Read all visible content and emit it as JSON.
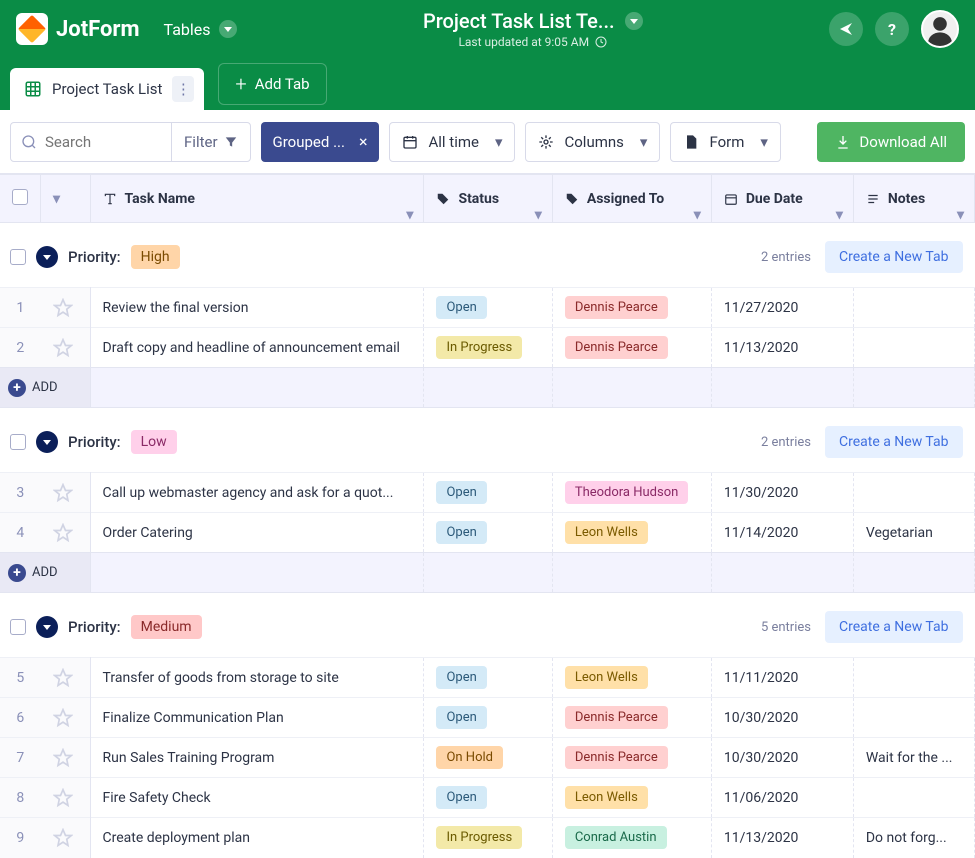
{
  "logo": "JotForm",
  "nav": {
    "tables": "Tables"
  },
  "header": {
    "title": "Project Task List Te...",
    "subtitle": "Last updated at 9:05 AM"
  },
  "tabs": {
    "main": "Project Task List",
    "add": "Add Tab"
  },
  "toolbar": {
    "search_placeholder": "Search",
    "filter": "Filter",
    "grouped": "Grouped ...",
    "alltime": "All time",
    "columns": "Columns",
    "form": "Form",
    "download": "Download All"
  },
  "columns": {
    "task": "Task Name",
    "status": "Status",
    "assigned": "Assigned To",
    "due": "Due Date",
    "notes": "Notes"
  },
  "group_label": "Priority:",
  "new_tab": "Create a New Tab",
  "add_label": "ADD",
  "groups": [
    {
      "priority": "High",
      "priority_class": "high",
      "entries": "2 entries",
      "rows": [
        {
          "idx": "1",
          "task": "Review the final version",
          "status": "Open",
          "status_class": "open",
          "assigned": "Dennis Pearce",
          "assigned_class": "dennis",
          "due": "11/27/2020",
          "notes": ""
        },
        {
          "idx": "2",
          "task": "Draft copy and headline of announcement email",
          "status": "In Progress",
          "status_class": "inprogress",
          "assigned": "Dennis Pearce",
          "assigned_class": "dennis",
          "due": "11/13/2020",
          "notes": ""
        }
      ]
    },
    {
      "priority": "Low",
      "priority_class": "low",
      "entries": "2 entries",
      "rows": [
        {
          "idx": "3",
          "task": "Call up webmaster agency and ask for a quot...",
          "status": "Open",
          "status_class": "open",
          "assigned": "Theodora Hudson",
          "assigned_class": "theodora",
          "due": "11/30/2020",
          "notes": ""
        },
        {
          "idx": "4",
          "task": "Order Catering",
          "status": "Open",
          "status_class": "open",
          "assigned": "Leon Wells",
          "assigned_class": "leon",
          "due": "11/14/2020",
          "notes": "Vegetarian"
        }
      ]
    },
    {
      "priority": "Medium",
      "priority_class": "medium",
      "entries": "5 entries",
      "rows": [
        {
          "idx": "5",
          "task": "Transfer of goods from storage to site",
          "status": "Open",
          "status_class": "open",
          "assigned": "Leon Wells",
          "assigned_class": "leon",
          "due": "11/11/2020",
          "notes": ""
        },
        {
          "idx": "6",
          "task": "Finalize Communication Plan",
          "status": "Open",
          "status_class": "open",
          "assigned": "Dennis Pearce",
          "assigned_class": "dennis",
          "due": "10/30/2020",
          "notes": ""
        },
        {
          "idx": "7",
          "task": "Run Sales Training Program",
          "status": "On Hold",
          "status_class": "onhold",
          "assigned": "Dennis Pearce",
          "assigned_class": "dennis",
          "due": "10/30/2020",
          "notes": "Wait for the ..."
        },
        {
          "idx": "8",
          "task": "Fire Safety Check",
          "status": "Open",
          "status_class": "open",
          "assigned": "Leon Wells",
          "assigned_class": "leon",
          "due": "11/06/2020",
          "notes": ""
        },
        {
          "idx": "9",
          "task": "Create deployment plan",
          "status": "In Progress",
          "status_class": "inprogress",
          "assigned": "Conrad Austin",
          "assigned_class": "conrad",
          "due": "11/13/2020",
          "notes": "Do not forg..."
        }
      ]
    }
  ]
}
